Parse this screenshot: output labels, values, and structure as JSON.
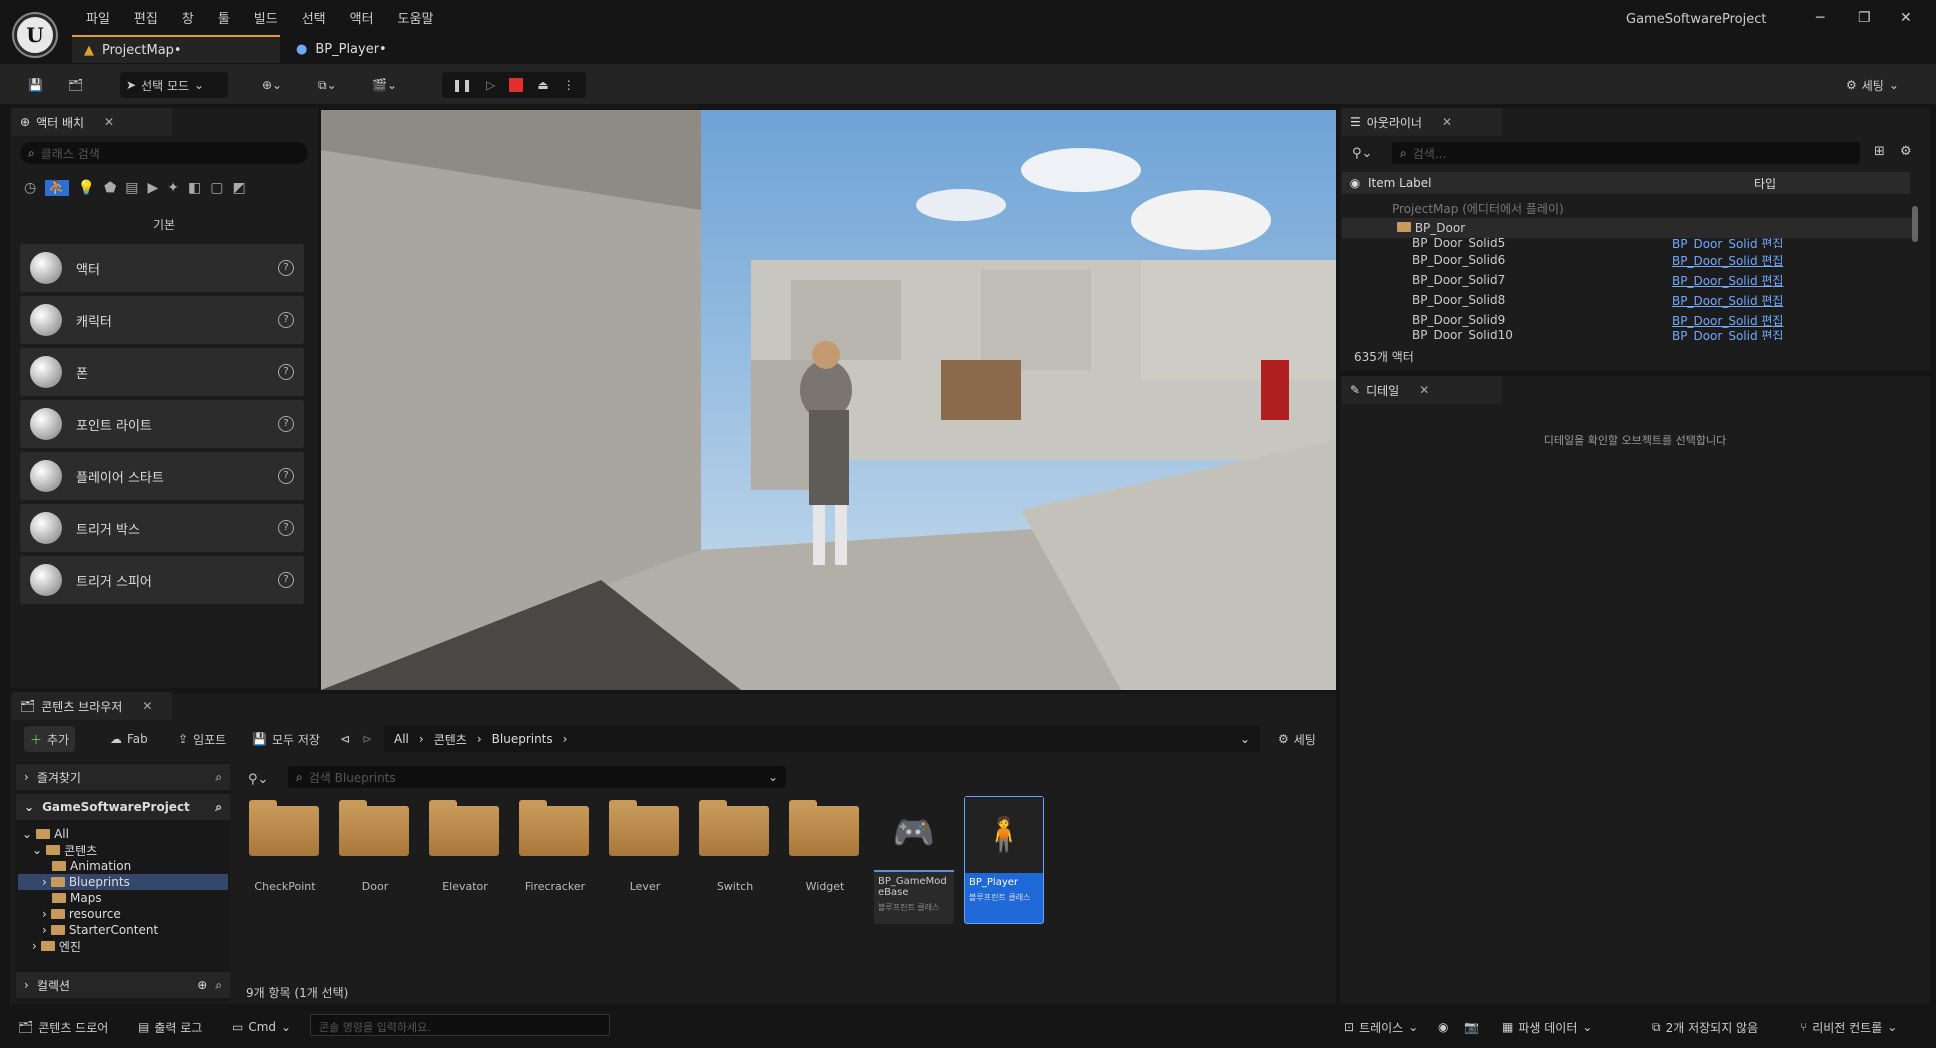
{
  "title_bar": {
    "menu": [
      "파일",
      "편집",
      "창",
      "툴",
      "빌드",
      "선택",
      "액터",
      "도움말"
    ],
    "tabs": [
      "ProjectMap•",
      "BP_Player•"
    ],
    "project_name": "GameSoftwareProject",
    "window_controls": [
      "─",
      "❐",
      "✕"
    ]
  },
  "toolbar": {
    "mode_label": "선택 모드",
    "settings_label": "세팅"
  },
  "place_actors": {
    "tab_label": "액터 배치",
    "search_placeholder": "클래스 검색",
    "category": "기본",
    "items": [
      "액터",
      "캐릭터",
      "폰",
      "포인트 라이트",
      "플레이어 스타트",
      "트리거 박스",
      "트리거 스피어"
    ]
  },
  "outliner": {
    "tab_label": "아웃라이너",
    "search_placeholder": "검색...",
    "col_label": "Item Label",
    "col_type": "타입",
    "map_row": "ProjectMap (에디터에서 플레이)",
    "folder_row": "BP_Door",
    "rows": [
      {
        "name": "BP_Door_Solid5",
        "type": "BP_Door_Solid 편집"
      },
      {
        "name": "BP_Door_Solid6",
        "type": "BP_Door_Solid 편집"
      },
      {
        "name": "BP_Door_Solid7",
        "type": "BP_Door_Solid 편집"
      },
      {
        "name": "BP_Door_Solid8",
        "type": "BP_Door_Solid 편집"
      },
      {
        "name": "BP_Door_Solid9",
        "type": "BP_Door_Solid 편집"
      },
      {
        "name": "BP_Door_Solid10",
        "type": "BP_Door_Solid 편집"
      }
    ],
    "count": "635개 액터"
  },
  "details": {
    "tab_label": "디테일",
    "empty_message": "디테일을 확인할 오브젝트를 선택합니다"
  },
  "content_browser": {
    "tab_label": "콘텐츠 브라우저",
    "add_label": "추가",
    "fab_label": "Fab",
    "import_label": "임포트",
    "save_all_label": "모두 저장",
    "path": [
      "All",
      "콘텐츠",
      "Blueprints"
    ],
    "settings_label": "세팅",
    "favorites_label": "즐겨찾기",
    "project_label": "GameSoftwareProject",
    "tree": [
      "All",
      "콘텐츠",
      "Animation",
      "Blueprints",
      "Maps",
      "resource",
      "StarterContent",
      "엔진"
    ],
    "collections_label": "컬렉션",
    "search_placeholder": "검색 Blueprints",
    "folders": [
      "CheckPoint",
      "Door",
      "Elevator",
      "Firecracker",
      "Lever",
      "Switch",
      "Widget"
    ],
    "assets": [
      {
        "name": "BP_GameModeBase",
        "type": "블루프린트 클래스"
      },
      {
        "name": "BP_Player",
        "type": "블루프린트 클래스"
      }
    ],
    "item_count": "9개 항목 (1개 선택)"
  },
  "status_bar": {
    "drawer_label": "콘텐츠 드로어",
    "output_label": "출력 로그",
    "cmd_label": "Cmd",
    "console_placeholder": "콘솔 명령을 입력하세요.",
    "trace_label": "트레이스",
    "derived_label": "파생 데이터",
    "unsaved_label": "2개 저장되지 않음",
    "revision_label": "리비전 컨트롤"
  }
}
